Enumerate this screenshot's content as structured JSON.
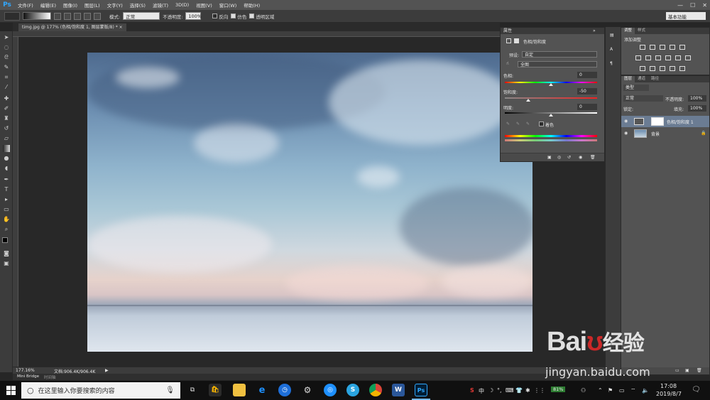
{
  "app": {
    "logo": "Ps"
  },
  "menu": [
    "文件(F)",
    "编辑(E)",
    "图像(I)",
    "图层(L)",
    "文字(Y)",
    "选择(S)",
    "滤镜(T)",
    "3D(D)",
    "视图(V)",
    "窗口(W)",
    "帮助(H)"
  ],
  "options_bar": {
    "mode_label": "模式:",
    "mode_value": "正常",
    "opacity_label": "不透明度:",
    "opacity_value": "100%",
    "reverse_label": "反向",
    "dither_label": "仿色",
    "transparency_label": "透明区域",
    "workspace": "基本功能"
  },
  "document": {
    "tab_label": "timg.jpg @ 177% (色相/饱和度 1, 图层蒙版/8) *",
    "close_glyph": "×"
  },
  "properties": {
    "panel_title": "属性",
    "adjustment_title": "色相/饱和度",
    "preset_label": "预设:",
    "preset_value": "自定",
    "channel_value": "全图",
    "hue_label": "色相:",
    "hue_value": "0",
    "saturation_label": "饱和度:",
    "saturation_value": "-50",
    "lightness_label": "明度:",
    "lightness_value": "0",
    "colorize_label": "着色"
  },
  "adjustments": {
    "tab_active": "调整",
    "tab_other": "样式",
    "add_label": "添加调整"
  },
  "layers": {
    "tabs": [
      "图层",
      "通道",
      "路径"
    ],
    "filter_label": "类型",
    "blend_value": "正常",
    "opacity_label": "不透明度:",
    "opacity_value": "100%",
    "lock_label": "锁定:",
    "fill_label": "填充:",
    "fill_value": "100%",
    "items": [
      {
        "name": "色相/饱和度 1"
      },
      {
        "name": "背景"
      }
    ]
  },
  "status": {
    "zoom": "177.16%",
    "doc_info": "文档:906.4K/906.4K"
  },
  "mini_bridge": {
    "tab1": "Mini Bridge",
    "tab2": "时间轴"
  },
  "taskbar": {
    "search_placeholder": "在这里输入你要搜索的内容",
    "ime": "中",
    "battery": "81%",
    "time": "17:08",
    "date": "2019/8/7"
  },
  "watermark": {
    "brand": "Bai",
    "brand2": "经验",
    "url": "jingyan.baidu.com"
  },
  "colors": {
    "accent": "#31a8ff",
    "panel": "#535353",
    "dark": "#3c3c3c",
    "taskbar": "#101010"
  }
}
